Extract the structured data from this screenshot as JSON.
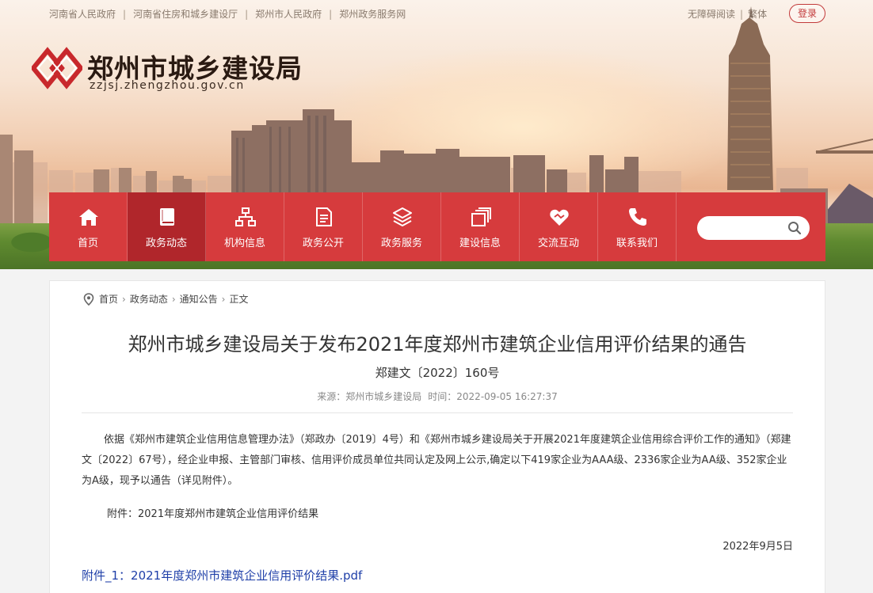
{
  "top_links": [
    "河南省人民政府",
    "河南省住房和城乡建设厅",
    "郑州市人民政府",
    "郑州政务服务网"
  ],
  "tools": {
    "accessibility": "无障碍阅读",
    "traditional": "繁体"
  },
  "login_label": "登录",
  "site": {
    "name": "郑州市城乡建设局",
    "domain": "zzjsj.zhengzhou.gov.cn"
  },
  "nav": [
    {
      "label": "首页",
      "icon": "home-icon"
    },
    {
      "label": "政务动态",
      "icon": "book-icon"
    },
    {
      "label": "机构信息",
      "icon": "org-chart-icon"
    },
    {
      "label": "政务公开",
      "icon": "document-icon"
    },
    {
      "label": "政务服务",
      "icon": "layers-icon"
    },
    {
      "label": "建设信息",
      "icon": "stack-icon"
    },
    {
      "label": "交流互动",
      "icon": "handshake-icon"
    },
    {
      "label": "联系我们",
      "icon": "phone-icon"
    }
  ],
  "search": {
    "placeholder": ""
  },
  "breadcrumb": [
    "首页",
    "政务动态",
    "通知公告",
    "正文"
  ],
  "article": {
    "title": "郑州市城乡建设局关于发布2021年度郑州市建筑企业信用评价结果的通告",
    "doc_number": "郑建文〔2022〕160号",
    "source": "来源：郑州市城乡建设局",
    "time": "时间：2022-09-05 16:27:37",
    "body": "依据《郑州市建筑企业信用信息管理办法》（郑政办〔2019〕4号）和《郑州市城乡建设局关于开展2021年度建筑企业信用综合评价工作的通知》（郑建文〔2022〕67号），经企业申报、主管部门审核、信用评价成员单位共同认定及网上公示,确定以下419家企业为AAA级、2336家企业为AA级、352家企业为A级，现予以通告（详见附件）。",
    "attachment_text": "附件：2021年度郑州市建筑企业信用评价结果",
    "date": "2022年9月5日",
    "file_link": "附件_1：2021年度郑州市建筑企业信用评价结果.pdf"
  },
  "colors": {
    "nav_red": "#d63b3d",
    "nav_active": "#b0262b",
    "link_blue": "#1f3fa8"
  }
}
